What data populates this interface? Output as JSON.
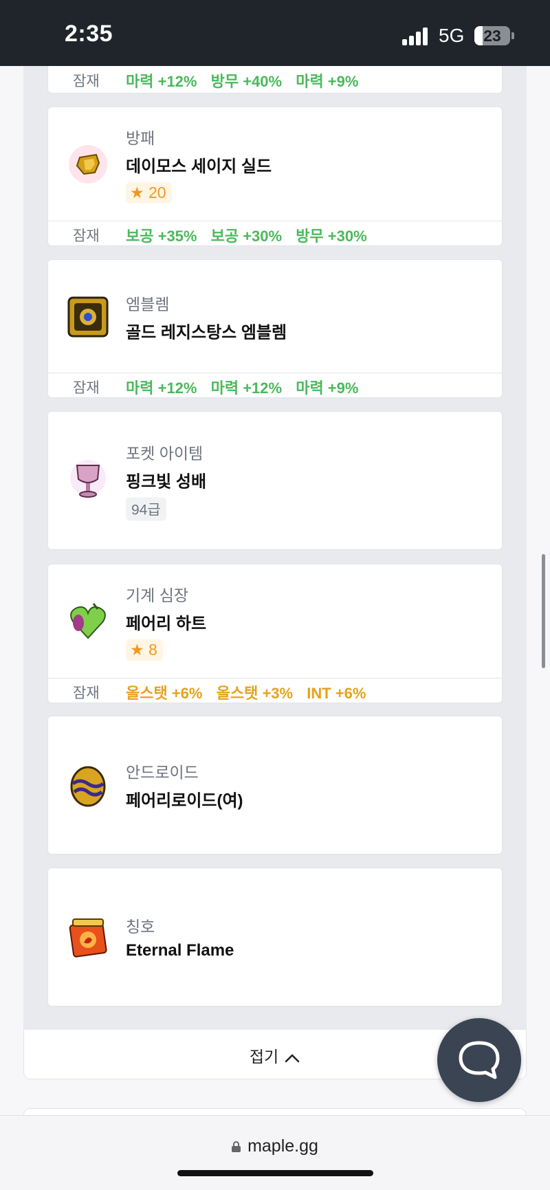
{
  "status_bar": {
    "time": "2:35",
    "network": "5G",
    "battery": "23"
  },
  "pot_label": "잠재",
  "top_card": {
    "potentials": [
      {
        "text": "마력 +12%",
        "color": "green"
      },
      {
        "text": "방무 +40%",
        "color": "green"
      },
      {
        "text": "마력 +9%",
        "color": "green"
      }
    ]
  },
  "items": [
    {
      "icon": "shield-icon",
      "category": "방패",
      "name": "데이모스 세이지 실드",
      "stars": "★ 20",
      "potentials": [
        "보공 +35%",
        "보공 +30%",
        "방무 +30%"
      ],
      "potential_color": "green"
    },
    {
      "icon": "emblem-icon",
      "category": "엠블렘",
      "name": "골드 레지스탕스 엠블렘",
      "potentials": [
        "마력 +12%",
        "마력 +12%",
        "마력 +9%"
      ],
      "potential_color": "green"
    },
    {
      "icon": "chalice-icon",
      "category": "포켓 아이템",
      "name": "핑크빛 성배",
      "grade": "94급"
    },
    {
      "icon": "heart-icon",
      "category": "기계 심장",
      "name": "페어리 하트",
      "stars": "★ 8",
      "potentials": [
        "올스탯 +6%",
        "올스탯 +3%",
        "INT +6%"
      ],
      "potential_color": "orange"
    },
    {
      "icon": "android-egg-icon",
      "category": "안드로이드",
      "name": "페어리로이드(여)"
    },
    {
      "icon": "title-medal-icon",
      "category": "칭호",
      "name": "Eternal Flame"
    }
  ],
  "fold_button": {
    "label": "접기"
  },
  "browser": {
    "url": "maple.gg"
  },
  "colors": {
    "potential_green": "#4cb85c",
    "potential_orange": "#e6a21b",
    "star": "#ee9a20",
    "fab": "#3a4452"
  }
}
